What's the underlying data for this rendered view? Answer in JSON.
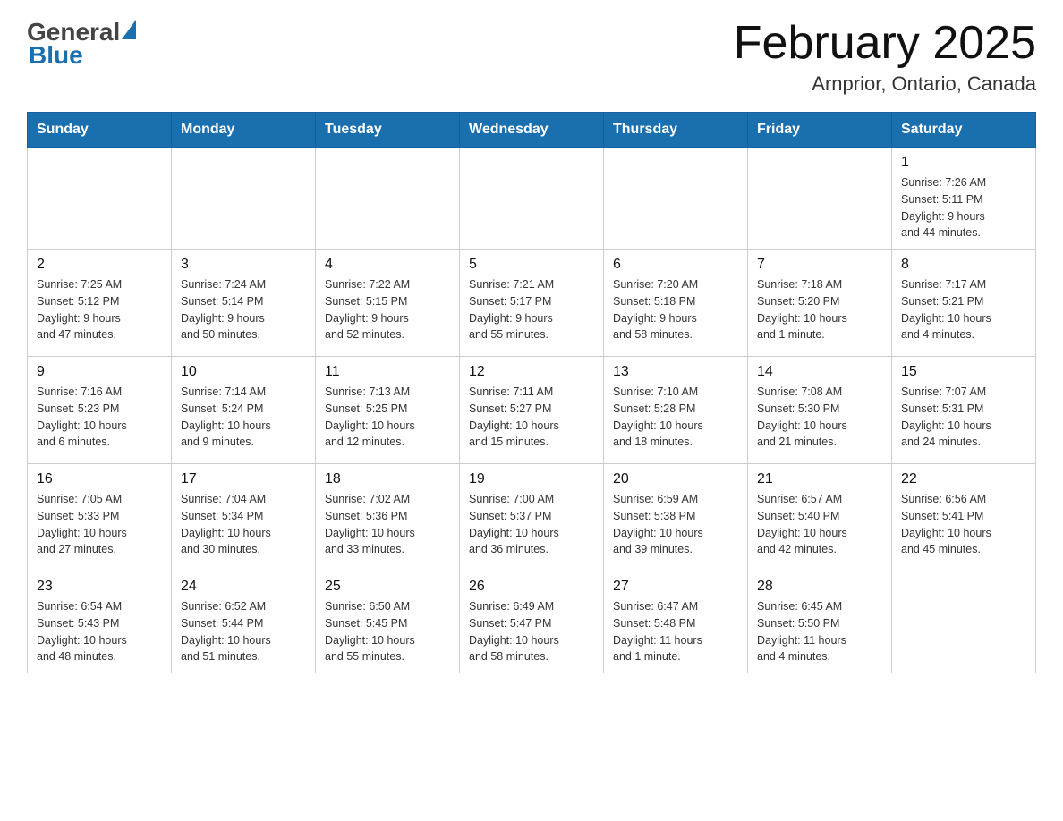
{
  "header": {
    "title": "February 2025",
    "subtitle": "Arnprior, Ontario, Canada",
    "logo_general": "General",
    "logo_blue": "Blue"
  },
  "weekdays": [
    "Sunday",
    "Monday",
    "Tuesday",
    "Wednesday",
    "Thursday",
    "Friday",
    "Saturday"
  ],
  "weeks": [
    {
      "days": [
        {
          "num": "",
          "info": ""
        },
        {
          "num": "",
          "info": ""
        },
        {
          "num": "",
          "info": ""
        },
        {
          "num": "",
          "info": ""
        },
        {
          "num": "",
          "info": ""
        },
        {
          "num": "",
          "info": ""
        },
        {
          "num": "1",
          "info": "Sunrise: 7:26 AM\nSunset: 5:11 PM\nDaylight: 9 hours\nand 44 minutes."
        }
      ]
    },
    {
      "days": [
        {
          "num": "2",
          "info": "Sunrise: 7:25 AM\nSunset: 5:12 PM\nDaylight: 9 hours\nand 47 minutes."
        },
        {
          "num": "3",
          "info": "Sunrise: 7:24 AM\nSunset: 5:14 PM\nDaylight: 9 hours\nand 50 minutes."
        },
        {
          "num": "4",
          "info": "Sunrise: 7:22 AM\nSunset: 5:15 PM\nDaylight: 9 hours\nand 52 minutes."
        },
        {
          "num": "5",
          "info": "Sunrise: 7:21 AM\nSunset: 5:17 PM\nDaylight: 9 hours\nand 55 minutes."
        },
        {
          "num": "6",
          "info": "Sunrise: 7:20 AM\nSunset: 5:18 PM\nDaylight: 9 hours\nand 58 minutes."
        },
        {
          "num": "7",
          "info": "Sunrise: 7:18 AM\nSunset: 5:20 PM\nDaylight: 10 hours\nand 1 minute."
        },
        {
          "num": "8",
          "info": "Sunrise: 7:17 AM\nSunset: 5:21 PM\nDaylight: 10 hours\nand 4 minutes."
        }
      ]
    },
    {
      "days": [
        {
          "num": "9",
          "info": "Sunrise: 7:16 AM\nSunset: 5:23 PM\nDaylight: 10 hours\nand 6 minutes."
        },
        {
          "num": "10",
          "info": "Sunrise: 7:14 AM\nSunset: 5:24 PM\nDaylight: 10 hours\nand 9 minutes."
        },
        {
          "num": "11",
          "info": "Sunrise: 7:13 AM\nSunset: 5:25 PM\nDaylight: 10 hours\nand 12 minutes."
        },
        {
          "num": "12",
          "info": "Sunrise: 7:11 AM\nSunset: 5:27 PM\nDaylight: 10 hours\nand 15 minutes."
        },
        {
          "num": "13",
          "info": "Sunrise: 7:10 AM\nSunset: 5:28 PM\nDaylight: 10 hours\nand 18 minutes."
        },
        {
          "num": "14",
          "info": "Sunrise: 7:08 AM\nSunset: 5:30 PM\nDaylight: 10 hours\nand 21 minutes."
        },
        {
          "num": "15",
          "info": "Sunrise: 7:07 AM\nSunset: 5:31 PM\nDaylight: 10 hours\nand 24 minutes."
        }
      ]
    },
    {
      "days": [
        {
          "num": "16",
          "info": "Sunrise: 7:05 AM\nSunset: 5:33 PM\nDaylight: 10 hours\nand 27 minutes."
        },
        {
          "num": "17",
          "info": "Sunrise: 7:04 AM\nSunset: 5:34 PM\nDaylight: 10 hours\nand 30 minutes."
        },
        {
          "num": "18",
          "info": "Sunrise: 7:02 AM\nSunset: 5:36 PM\nDaylight: 10 hours\nand 33 minutes."
        },
        {
          "num": "19",
          "info": "Sunrise: 7:00 AM\nSunset: 5:37 PM\nDaylight: 10 hours\nand 36 minutes."
        },
        {
          "num": "20",
          "info": "Sunrise: 6:59 AM\nSunset: 5:38 PM\nDaylight: 10 hours\nand 39 minutes."
        },
        {
          "num": "21",
          "info": "Sunrise: 6:57 AM\nSunset: 5:40 PM\nDaylight: 10 hours\nand 42 minutes."
        },
        {
          "num": "22",
          "info": "Sunrise: 6:56 AM\nSunset: 5:41 PM\nDaylight: 10 hours\nand 45 minutes."
        }
      ]
    },
    {
      "days": [
        {
          "num": "23",
          "info": "Sunrise: 6:54 AM\nSunset: 5:43 PM\nDaylight: 10 hours\nand 48 minutes."
        },
        {
          "num": "24",
          "info": "Sunrise: 6:52 AM\nSunset: 5:44 PM\nDaylight: 10 hours\nand 51 minutes."
        },
        {
          "num": "25",
          "info": "Sunrise: 6:50 AM\nSunset: 5:45 PM\nDaylight: 10 hours\nand 55 minutes."
        },
        {
          "num": "26",
          "info": "Sunrise: 6:49 AM\nSunset: 5:47 PM\nDaylight: 10 hours\nand 58 minutes."
        },
        {
          "num": "27",
          "info": "Sunrise: 6:47 AM\nSunset: 5:48 PM\nDaylight: 11 hours\nand 1 minute."
        },
        {
          "num": "28",
          "info": "Sunrise: 6:45 AM\nSunset: 5:50 PM\nDaylight: 11 hours\nand 4 minutes."
        },
        {
          "num": "",
          "info": ""
        }
      ]
    }
  ]
}
